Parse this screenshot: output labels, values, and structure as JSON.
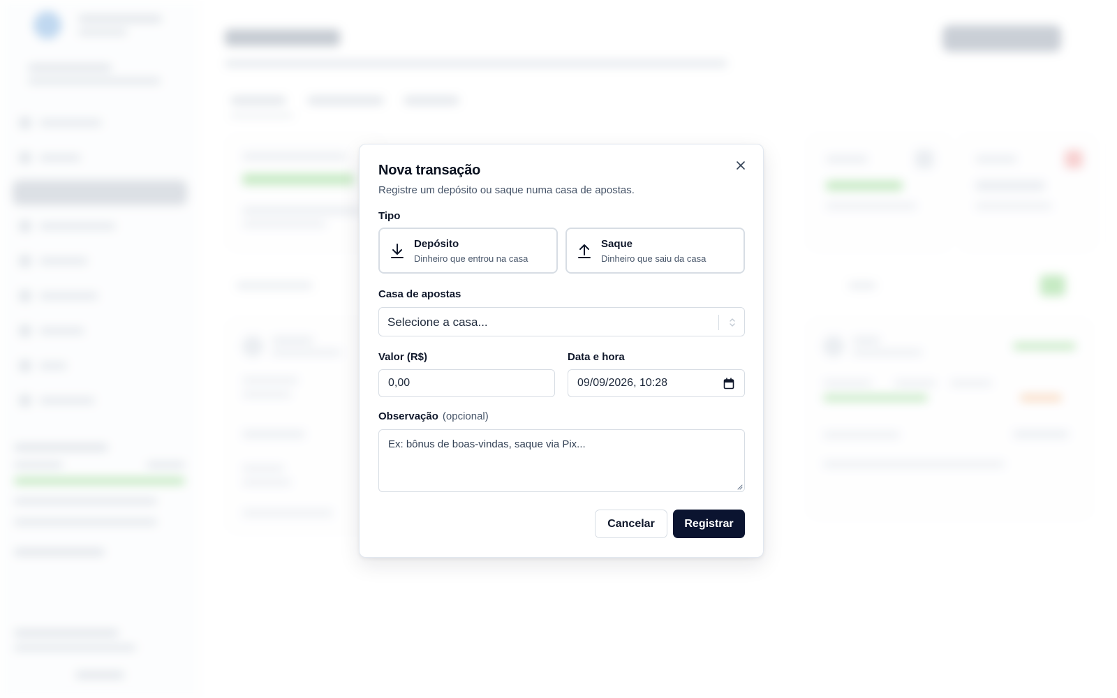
{
  "modal": {
    "title": "Nova transação",
    "description": "Registre um depósito ou saque numa casa de apostas.",
    "type_label": "Tipo",
    "types": [
      {
        "title": "Depósito",
        "subtitle": "Dinheiro que entrou na casa",
        "icon": "download-icon"
      },
      {
        "title": "Saque",
        "subtitle": "Dinheiro que saiu da casa",
        "icon": "upload-icon"
      }
    ],
    "house_label": "Casa de apostas",
    "house_placeholder": "Selecione a casa...",
    "amount_label": "Valor (R$)",
    "amount_value": "0,00",
    "datetime_label": "Data e hora",
    "datetime_value": "09/09/2026, 10:28",
    "note_label": "Observação",
    "note_optional": "(opcional)",
    "note_placeholder": "Ex: bônus de boas-vindas, saque via Pix...",
    "cancel_label": "Cancelar",
    "submit_label": "Registrar"
  },
  "colors": {
    "primary_button": "#0b1430",
    "border": "#d7dde4",
    "muted_text": "#475569"
  }
}
